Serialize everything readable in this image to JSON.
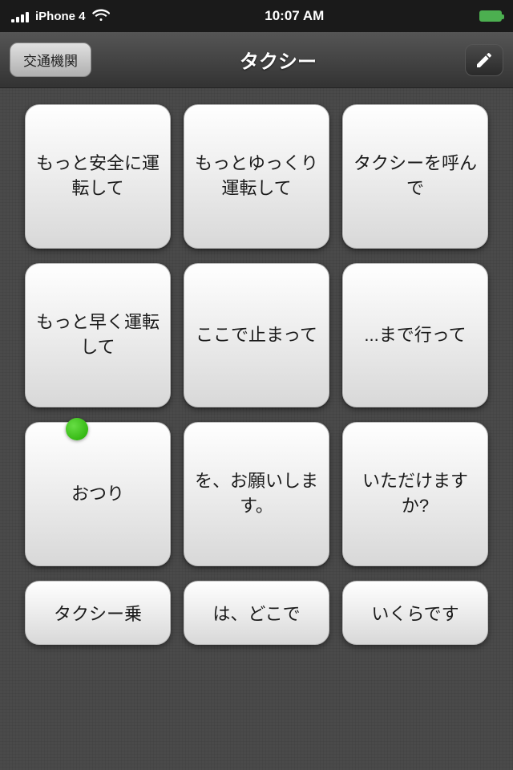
{
  "statusBar": {
    "carrier": "iPhone 4",
    "time": "10:07 AM",
    "wifiSymbol": "📶"
  },
  "navBar": {
    "backLabel": "交通機関",
    "title": "タクシー",
    "editIconAlt": "edit"
  },
  "grid": {
    "rows": [
      [
        {
          "id": "cell-1",
          "text": "もっと安全に運転して"
        },
        {
          "id": "cell-2",
          "text": "もっとゆっくり運転して"
        },
        {
          "id": "cell-3",
          "text": "タクシーを呼んで"
        }
      ],
      [
        {
          "id": "cell-4",
          "text": "もっと早く運転して"
        },
        {
          "id": "cell-5",
          "text": "ここで止まって"
        },
        {
          "id": "cell-6",
          "text": "...まで行って"
        }
      ],
      [
        {
          "id": "cell-7",
          "text": "おつり",
          "hasDot": true
        },
        {
          "id": "cell-8",
          "text": "を、お願いします。"
        },
        {
          "id": "cell-9",
          "text": "いただけますか?"
        }
      ]
    ],
    "partialRow": [
      {
        "id": "cell-10",
        "text": "タクシー乗"
      },
      {
        "id": "cell-11",
        "text": "は、どこで"
      },
      {
        "id": "cell-12",
        "text": "いくらです"
      }
    ]
  }
}
